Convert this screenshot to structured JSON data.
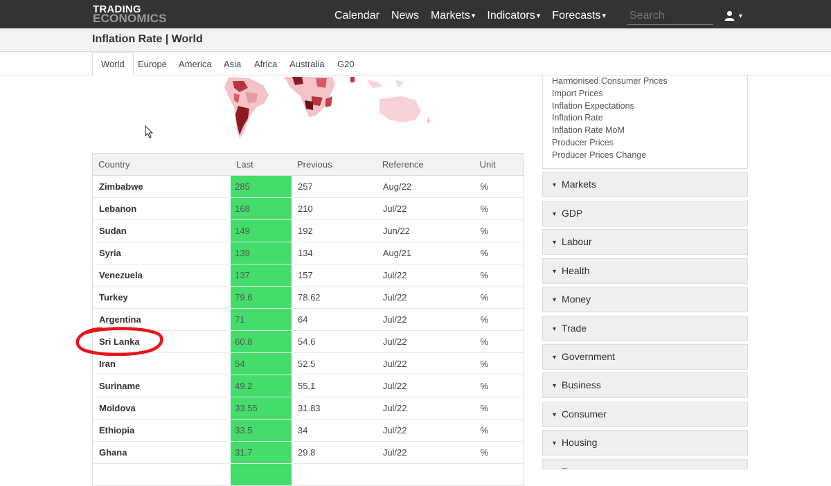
{
  "header": {
    "logo_line1": "TRADING",
    "logo_line2": "ECONOMICS",
    "nav": [
      "Calendar",
      "News",
      "Markets",
      "Indicators",
      "Forecasts"
    ],
    "search_placeholder": "Search",
    "user_icon": "user-icon"
  },
  "page_title": "Inflation Rate | World",
  "tabs": [
    "World",
    "Europe",
    "America",
    "Asia",
    "Africa",
    "Australia",
    "G20"
  ],
  "active_tab": "World",
  "table": {
    "headers": [
      "Country",
      "Last",
      "Previous",
      "Reference",
      "Unit"
    ],
    "rows": [
      {
        "country": "Zimbabwe",
        "last": "285",
        "previous": "257",
        "reference": "Aug/22",
        "unit": "%"
      },
      {
        "country": "Lebanon",
        "last": "168",
        "previous": "210",
        "reference": "Jul/22",
        "unit": "%"
      },
      {
        "country": "Sudan",
        "last": "149",
        "previous": "192",
        "reference": "Jun/22",
        "unit": "%"
      },
      {
        "country": "Syria",
        "last": "139",
        "previous": "134",
        "reference": "Aug/21",
        "unit": "%"
      },
      {
        "country": "Venezuela",
        "last": "137",
        "previous": "157",
        "reference": "Jul/22",
        "unit": "%"
      },
      {
        "country": "Turkey",
        "last": "79.6",
        "previous": "78.62",
        "reference": "Jul/22",
        "unit": "%"
      },
      {
        "country": "Argentina",
        "last": "71",
        "previous": "64",
        "reference": "Jul/22",
        "unit": "%"
      },
      {
        "country": "Sri Lanka",
        "last": "60.8",
        "previous": "54.6",
        "reference": "Jul/22",
        "unit": "%"
      },
      {
        "country": "Iran",
        "last": "54",
        "previous": "52.5",
        "reference": "Jul/22",
        "unit": "%"
      },
      {
        "country": "Suriname",
        "last": "49.2",
        "previous": "55.1",
        "reference": "Jul/22",
        "unit": "%"
      },
      {
        "country": "Moldova",
        "last": "33.55",
        "previous": "31.83",
        "reference": "Jul/22",
        "unit": "%"
      },
      {
        "country": "Ethiopia",
        "last": "33.5",
        "previous": "34",
        "reference": "Jul/22",
        "unit": "%"
      },
      {
        "country": "Ghana",
        "last": "31.7",
        "previous": "29.8",
        "reference": "Jul/22",
        "unit": "%"
      }
    ],
    "highlight_color": "#44dc6a"
  },
  "related_links": [
    "Harmonised Consumer Prices",
    "Import Prices",
    "Inflation Expectations",
    "Inflation Rate",
    "Inflation Rate MoM",
    "Producer Prices",
    "Producer Prices Change"
  ],
  "sections": [
    "Markets",
    "GDP",
    "Labour",
    "Health",
    "Money",
    "Trade",
    "Government",
    "Business",
    "Consumer",
    "Housing",
    "Taxes"
  ],
  "annotation": {
    "circled_country": "Sri Lanka",
    "circle_color": "#e8141c"
  }
}
